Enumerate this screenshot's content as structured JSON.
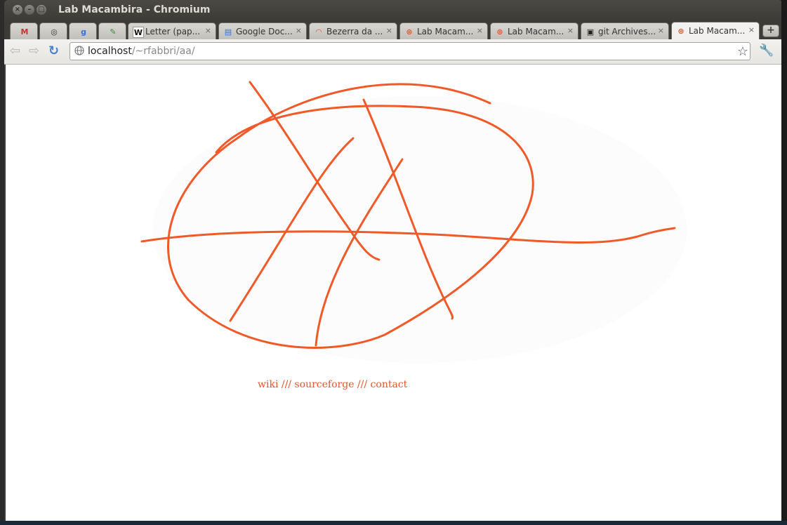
{
  "window": {
    "title": "Lab Macambira - Chromium"
  },
  "tabs": [
    {
      "icon": "gmail-icon",
      "glyph": "M",
      "color": "#c5352b",
      "label": "",
      "close": ""
    },
    {
      "icon": "chrome-icon",
      "glyph": "◎",
      "color": "#333333",
      "label": "",
      "close": ""
    },
    {
      "icon": "google-icon",
      "glyph": "g",
      "color": "#3a6fd8",
      "label": "",
      "close": ""
    },
    {
      "icon": "pencil-icon",
      "glyph": "✎",
      "color": "#3a8a3a",
      "label": "",
      "close": ""
    },
    {
      "icon": "wikipedia-icon",
      "glyph": "W",
      "color": "#111111",
      "label": "Letter (pap...",
      "close": "×"
    },
    {
      "icon": "docs-icon",
      "glyph": "▤",
      "color": "#3a6fd8",
      "label": "Google Doc...",
      "close": "×"
    },
    {
      "icon": "arc-icon",
      "glyph": "◠",
      "color": "#e8532d",
      "label": "Bezerra da ...",
      "close": "×"
    },
    {
      "icon": "macambira-icon",
      "glyph": "⊛",
      "color": "#e8532d",
      "label": "Lab Macam...",
      "close": "×"
    },
    {
      "icon": "macambira-icon",
      "glyph": "⊛",
      "color": "#e8532d",
      "label": "Lab Macam...",
      "close": "×"
    },
    {
      "icon": "git-icon",
      "glyph": "▣",
      "color": "#222222",
      "label": "git Archives...",
      "close": "×"
    },
    {
      "icon": "macambira-icon",
      "glyph": "⊛",
      "color": "#e8532d",
      "label": "Lab Macam...",
      "close": "×"
    }
  ],
  "toolbar": {
    "url_host": "localhost",
    "url_path": "/~rfabbri/aa/"
  },
  "page": {
    "link_wiki": "wiki",
    "sep1": " /// ",
    "link_sourceforge": "sourceforge",
    "sep2": " /// ",
    "link_contact": "contact",
    "accent_color": "#e8532d"
  }
}
